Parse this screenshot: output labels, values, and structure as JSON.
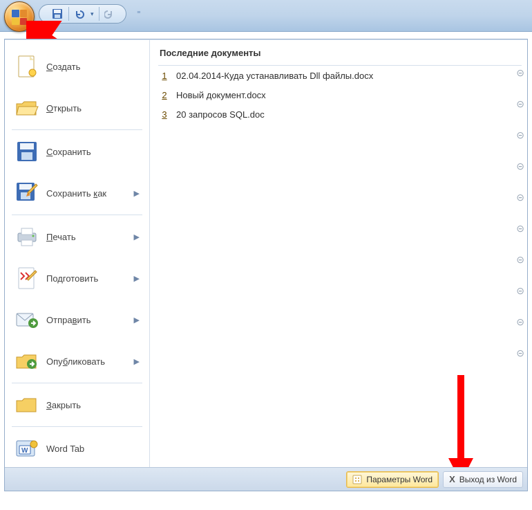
{
  "titlebar": {
    "qat": {
      "save": "save",
      "undo": "undo",
      "redo": "redo"
    }
  },
  "menu": {
    "items": [
      {
        "label": "Создать",
        "underline": "С",
        "rest": "оздать",
        "has_arrow": false,
        "icon": "new"
      },
      {
        "label": "Открыть",
        "underline": "О",
        "rest": "ткрыть",
        "has_arrow": false,
        "icon": "open"
      },
      {
        "label": "Сохранить",
        "underline": "С",
        "rest": "охранить",
        "has_arrow": false,
        "icon": "save"
      },
      {
        "label": "Сохранить как",
        "underline": "к",
        "pre": "Сохранить ",
        "rest": "ак",
        "has_arrow": true,
        "icon": "saveas"
      },
      {
        "label": "Печать",
        "underline": "П",
        "rest": "ечать",
        "has_arrow": true,
        "icon": "print"
      },
      {
        "label": "Подготовить",
        "underline": "д",
        "pre": "По",
        "rest": "готовить",
        "has_arrow": true,
        "icon": "prepare"
      },
      {
        "label": "Отправить",
        "underline": "в",
        "pre": "Отпра",
        "rest": "ить",
        "has_arrow": true,
        "icon": "send"
      },
      {
        "label": "Опубликовать",
        "underline": "б",
        "pre": "Опу",
        "rest": "ликовать",
        "has_arrow": true,
        "icon": "publish"
      },
      {
        "label": "Закрыть",
        "underline": "З",
        "rest": "акрыть",
        "has_arrow": false,
        "icon": "close"
      },
      {
        "label": "Word Tab",
        "underline": "",
        "rest": "Word Tab",
        "has_arrow": false,
        "icon": "wordtab"
      }
    ]
  },
  "recent": {
    "title": "Последние документы",
    "items": [
      {
        "n": "1",
        "name": "02.04.2014-Куда устанавливать Dll файлы.docx"
      },
      {
        "n": "2",
        "name": "Новый документ.docx"
      },
      {
        "n": "3",
        "name": "20 запросов SQL.doc"
      }
    ]
  },
  "bottom": {
    "options": "Параметры Word",
    "exit": "Выход из Word"
  }
}
